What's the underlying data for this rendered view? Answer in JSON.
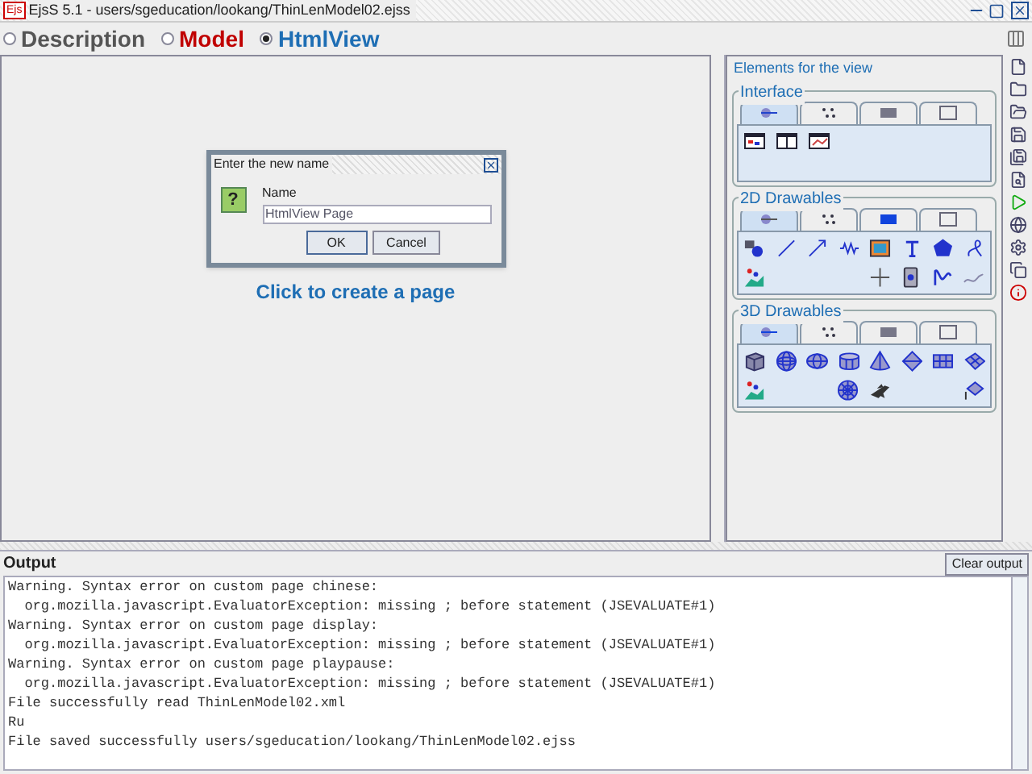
{
  "window": {
    "title": "EjsS 5.1 - users/sgeducation/lookang/ThinLenModel02.ejss",
    "app_badge": "Ejs"
  },
  "tabs": [
    {
      "label": "Description",
      "selected": false,
      "color": "#555555"
    },
    {
      "label": "Model",
      "selected": false,
      "color": "#c00000"
    },
    {
      "label": "HtmlView",
      "selected": true,
      "color": "#1e6eb4"
    }
  ],
  "dialog": {
    "title": "Enter the new name",
    "icon_glyph": "?",
    "field_label": "Name",
    "field_value": "HtmlView Page",
    "buttons": [
      "OK",
      "Cancel"
    ]
  },
  "create_page_link": "Click to create a page",
  "elements_panel": {
    "title": "Elements for the view",
    "groups": [
      {
        "title": "Interface",
        "tabs": [
          {
            "selected": true
          },
          {
            "selected": false
          },
          {
            "selected": false
          },
          {
            "selected": false
          }
        ]
      },
      {
        "title": "2D Drawables",
        "tabs": [
          {
            "selected": true
          },
          {
            "selected": false
          },
          {
            "selected": false
          },
          {
            "selected": false
          }
        ]
      },
      {
        "title": "3D Drawables",
        "tabs": [
          {
            "selected": true
          },
          {
            "selected": false
          },
          {
            "selected": false
          },
          {
            "selected": false
          }
        ]
      }
    ]
  },
  "output": {
    "title": "Output",
    "clear_button": "Clear output",
    "lines": [
      "Warning. Syntax error on custom page chinese:",
      "  org.mozilla.javascript.EvaluatorException: missing ; before statement (JSEVALUATE#1)",
      "Warning. Syntax error on custom page display:",
      "  org.mozilla.javascript.EvaluatorException: missing ; before statement (JSEVALUATE#1)",
      "Warning. Syntax error on custom page playpause:",
      "  org.mozilla.javascript.EvaluatorException: missing ; before statement (JSEVALUATE#1)",
      "File successfully read ThinLenModel02.xml",
      "Ru",
      "File saved successfully users/sgeducation/lookang/ThinLenModel02.ejss"
    ]
  }
}
